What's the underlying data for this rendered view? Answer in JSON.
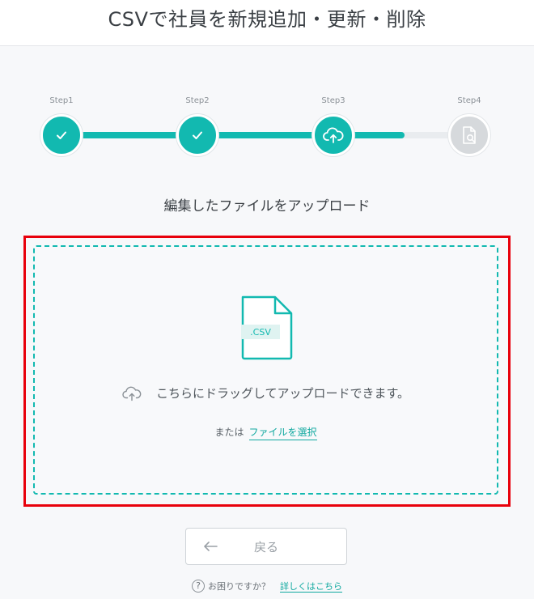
{
  "header": {
    "title": "CSVで社員を新規追加・更新・削除"
  },
  "stepper": {
    "steps": [
      {
        "label": "Step1",
        "state": "done",
        "icon": "check-icon"
      },
      {
        "label": "Step2",
        "state": "done",
        "icon": "check-icon"
      },
      {
        "label": "Step3",
        "state": "current",
        "icon": "cloud-upload-icon"
      },
      {
        "label": "Step4",
        "state": "pending",
        "icon": "document-search-icon"
      }
    ],
    "colors": {
      "active": "#12b9b0",
      "inactive": "#d6d9dc"
    }
  },
  "main": {
    "subtitle": "編集したファイルをアップロード",
    "dropzone": {
      "file_badge": ".CSV",
      "message": "こちらにドラッグしてアップロードできます。",
      "alt_prefix": "または",
      "select_link": "ファイルを選択",
      "highlight_color": "#e8000b"
    }
  },
  "footer": {
    "back_label": "戻る",
    "help_question": "お困りですか？",
    "help_link": "詳しくはこちら"
  }
}
